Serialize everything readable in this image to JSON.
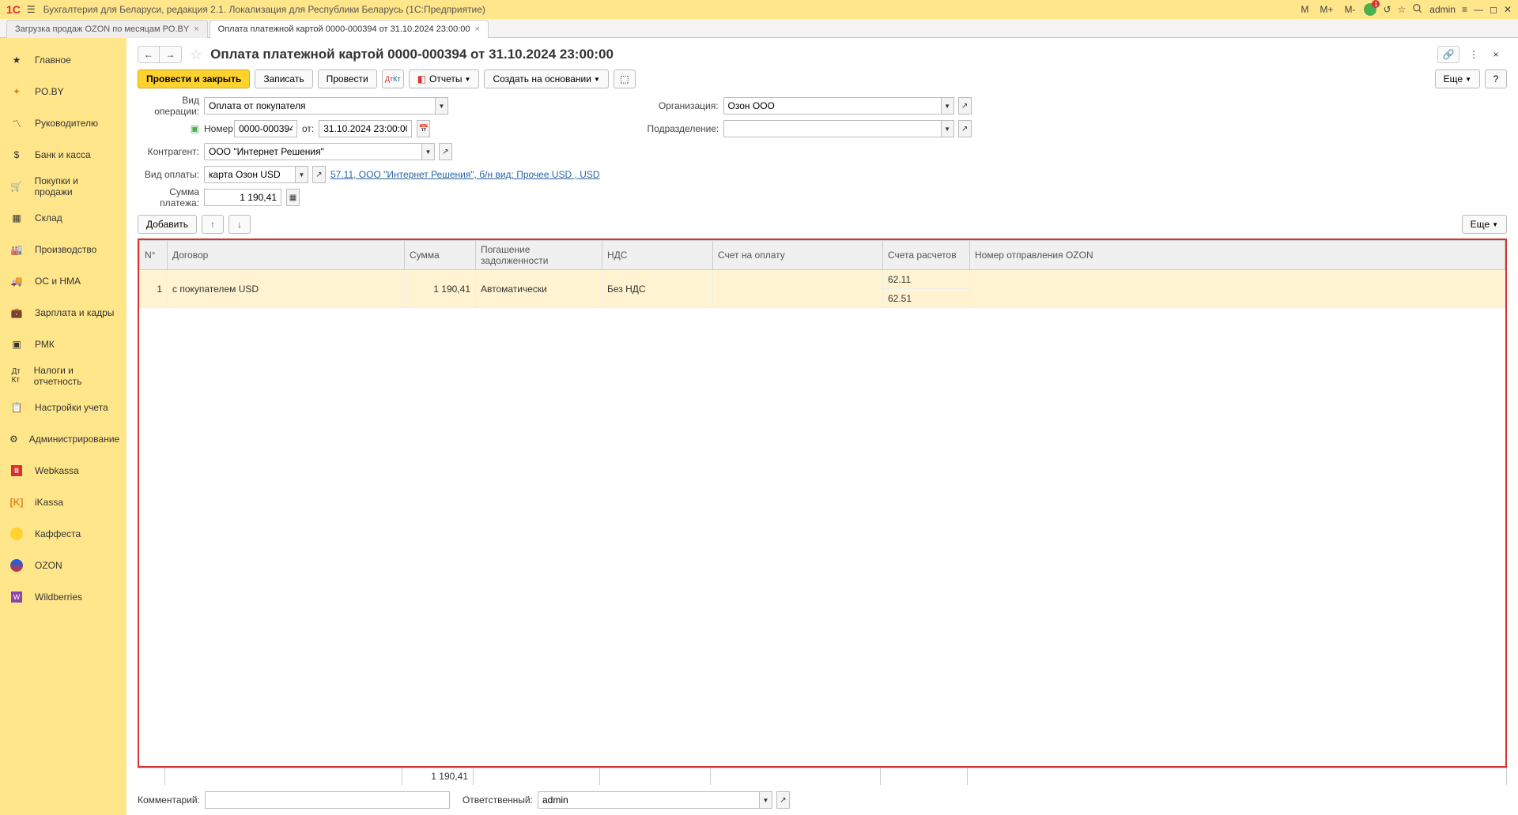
{
  "app_title": "Бухгалтерия для Беларуси, редакция 2.1. Локализация для Республики Беларусь   (1С:Предприятие)",
  "top_buttons": {
    "m": "M",
    "m_plus": "M+",
    "m_minus": "M-",
    "user": "admin"
  },
  "tabs": [
    {
      "label": "Загрузка продаж OZON по месяцам PO.BY"
    },
    {
      "label": "Оплата платежной картой 0000-000394 от 31.10.2024 23:00:00"
    }
  ],
  "sidebar": [
    {
      "label": "Главное"
    },
    {
      "label": "PO.BY"
    },
    {
      "label": "Руководителю"
    },
    {
      "label": "Банк и касса"
    },
    {
      "label": "Покупки и продажи"
    },
    {
      "label": "Склад"
    },
    {
      "label": "Производство"
    },
    {
      "label": "ОС и НМА"
    },
    {
      "label": "Зарплата и кадры"
    },
    {
      "label": "РМК"
    },
    {
      "label": "Налоги и отчетность"
    },
    {
      "label": "Настройки учета"
    },
    {
      "label": "Администрирование"
    },
    {
      "label": "Webkassa"
    },
    {
      "label": "iKassa"
    },
    {
      "label": "Каффеста"
    },
    {
      "label": "OZON"
    },
    {
      "label": "Wildberries"
    }
  ],
  "doc": {
    "title": "Оплата платежной картой 0000-000394 от 31.10.2024 23:00:00",
    "buttons": {
      "post_close": "Провести и закрыть",
      "save": "Записать",
      "post": "Провести",
      "reports": "Отчеты",
      "create": "Создать на основании",
      "more": "Еще",
      "add": "Добавить"
    },
    "labels": {
      "op_type": "Вид операции:",
      "number": "Номер:",
      "from": "от:",
      "counterparty": "Контрагент:",
      "payment_type": "Вид оплаты:",
      "sum": "Сумма платежа:",
      "org": "Организация:",
      "division": "Подразделение:",
      "comment": "Комментарий:",
      "responsible": "Ответственный:"
    },
    "fields": {
      "op_type": "Оплата от покупателя",
      "number": "0000-000394",
      "date": "31.10.2024 23:00:00",
      "counterparty": "ООО \"Интернет Решения\"",
      "payment_type": "карта Озон USD",
      "account_link": "57.11, ООО \"Интернет Решения\", б/н вид: Прочее USD , USD",
      "sum": "1 190,41",
      "org": "Озон ООО",
      "division": "",
      "comment": "",
      "responsible": "admin"
    },
    "table": {
      "headers": [
        "N°",
        "Договор",
        "Сумма",
        "Погашение задолженности",
        "НДС",
        "Счет на оплату",
        "Счета расчетов",
        "Номер отправления OZON"
      ],
      "rows": [
        {
          "num": "1",
          "contract": "с покупателем USD",
          "sum": "1 190,41",
          "repay": "Автоматически",
          "nds": "Без НДС",
          "invoice": "",
          "acc1": "62.11",
          "acc2": "62.51",
          "ozon": ""
        }
      ],
      "footer_sum": "1 190,41"
    }
  }
}
